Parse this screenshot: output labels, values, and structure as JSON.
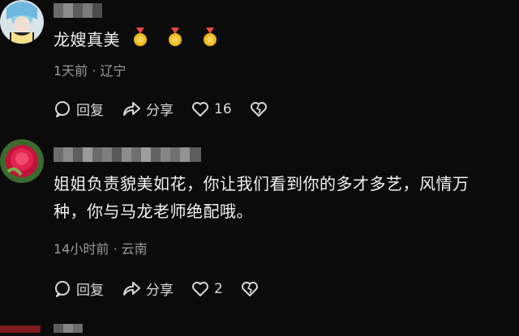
{
  "comments": [
    {
      "text": "龙嫂真美",
      "location_time": "1天前 · 辽宁",
      "reply_label": "回复",
      "share_label": "分享",
      "likes": "16",
      "emoji_count": 3
    },
    {
      "text_line1": "姐姐负责貌美如花，你让我们看到你的多才多艺，风情万",
      "text_line2": "种，你与马龙老师绝配哦。",
      "location_time": "14小时前 · 云南",
      "reply_label": "回复",
      "share_label": "分享",
      "likes": "2"
    }
  ],
  "icons": [
    "comment-icon",
    "share-icon",
    "heart-icon",
    "broken-heart-icon",
    "medal-emoji"
  ]
}
